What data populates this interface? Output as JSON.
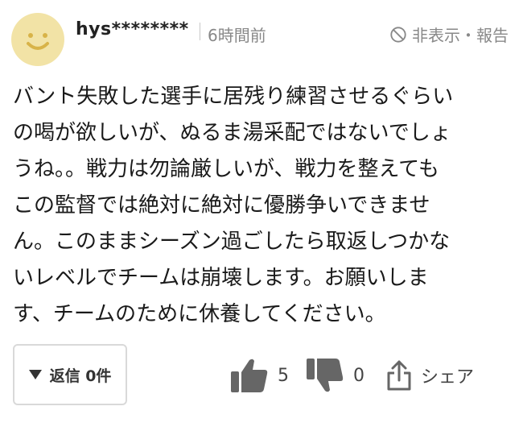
{
  "comment": {
    "username": "hys********",
    "time": "6時間前",
    "hide_report": "非表示・報告",
    "lines": [
      "バント失敗した選手に居残り練習させるぐらい",
      "の喝が欲しいが、ぬるま湯采配ではないでしょ",
      "うね。。戦力は勿論厳しいが、戦力を整えても",
      "この監督では絶対に絶対に優勝争いできませ",
      "ん。このままシーズン過ごしたら取返しつかな",
      "いレベルでチームは崩壊します。お願いしま",
      "す、チームのために休養してください。"
    ]
  },
  "actions": {
    "reply_label": "返信 0件",
    "like_count": "5",
    "dislike_count": "0",
    "share_label": "シェア"
  },
  "icons": {
    "avatar": "smiley-face-icon",
    "hide": "prohibit-icon",
    "reply": "triangle-down-icon",
    "like": "thumbs-up-icon",
    "dislike": "thumbs-down-icon",
    "share": "share-icon"
  },
  "colors": {
    "avatar_bg": "#f2e3a6",
    "avatar_face": "#d8b348",
    "icon_gray": "#666666",
    "muted_text": "#888888"
  }
}
